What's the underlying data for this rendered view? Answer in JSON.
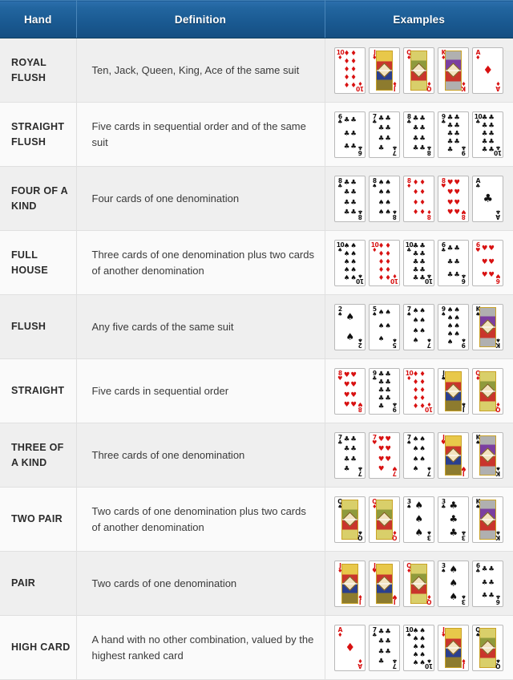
{
  "table": {
    "headers": [
      "Hand",
      "Definition",
      "Examples"
    ],
    "rows": [
      {
        "hand": "ROYAL FLUSH",
        "definition": "Ten, Jack, Queen, King, Ace of the same suit",
        "cards": [
          {
            "rank": "10",
            "suit": "diamonds"
          },
          {
            "rank": "J",
            "suit": "diamonds"
          },
          {
            "rank": "Q",
            "suit": "diamonds"
          },
          {
            "rank": "K",
            "suit": "diamonds"
          },
          {
            "rank": "A",
            "suit": "diamonds"
          }
        ]
      },
      {
        "hand": "STRAIGHT FLUSH",
        "definition": "Five cards in sequential order and of the same suit",
        "cards": [
          {
            "rank": "6",
            "suit": "clubs"
          },
          {
            "rank": "7",
            "suit": "clubs"
          },
          {
            "rank": "8",
            "suit": "clubs"
          },
          {
            "rank": "9",
            "suit": "clubs"
          },
          {
            "rank": "10",
            "suit": "clubs"
          }
        ]
      },
      {
        "hand": "FOUR OF A KIND",
        "definition": "Four cards of one denomination",
        "cards": [
          {
            "rank": "8",
            "suit": "clubs"
          },
          {
            "rank": "8",
            "suit": "spades"
          },
          {
            "rank": "8",
            "suit": "diamonds"
          },
          {
            "rank": "8",
            "suit": "hearts"
          },
          {
            "rank": "A",
            "suit": "clubs"
          }
        ]
      },
      {
        "hand": "FULL HOUSE",
        "definition": "Three cards of one denomination plus two cards of another denomination",
        "cards": [
          {
            "rank": "10",
            "suit": "spades"
          },
          {
            "rank": "10",
            "suit": "diamonds"
          },
          {
            "rank": "10",
            "suit": "clubs"
          },
          {
            "rank": "6",
            "suit": "clubs"
          },
          {
            "rank": "6",
            "suit": "hearts"
          }
        ]
      },
      {
        "hand": "FLUSH",
        "definition": "Any five cards of the same suit",
        "cards": [
          {
            "rank": "2",
            "suit": "spades"
          },
          {
            "rank": "5",
            "suit": "spades"
          },
          {
            "rank": "7",
            "suit": "spades"
          },
          {
            "rank": "9",
            "suit": "spades"
          },
          {
            "rank": "K",
            "suit": "spades"
          }
        ]
      },
      {
        "hand": "STRAIGHT",
        "definition": "Five cards in sequential order",
        "cards": [
          {
            "rank": "8",
            "suit": "hearts"
          },
          {
            "rank": "9",
            "suit": "clubs"
          },
          {
            "rank": "10",
            "suit": "diamonds"
          },
          {
            "rank": "J",
            "suit": "spades"
          },
          {
            "rank": "Q",
            "suit": "diamonds"
          }
        ]
      },
      {
        "hand": "THREE OF A KIND",
        "definition": "Three cards of one denomination",
        "cards": [
          {
            "rank": "7",
            "suit": "clubs"
          },
          {
            "rank": "7",
            "suit": "hearts"
          },
          {
            "rank": "7",
            "suit": "spades"
          },
          {
            "rank": "J",
            "suit": "hearts"
          },
          {
            "rank": "K",
            "suit": "spades"
          }
        ]
      },
      {
        "hand": "TWO PAIR",
        "definition": "Two cards of one denomination plus two cards of another denomination",
        "cards": [
          {
            "rank": "Q",
            "suit": "spades"
          },
          {
            "rank": "Q",
            "suit": "diamonds"
          },
          {
            "rank": "3",
            "suit": "spades"
          },
          {
            "rank": "3",
            "suit": "clubs"
          },
          {
            "rank": "K",
            "suit": "spades"
          }
        ]
      },
      {
        "hand": "PAIR",
        "definition": "Two cards of one denomination",
        "cards": [
          {
            "rank": "J",
            "suit": "diamonds"
          },
          {
            "rank": "J",
            "suit": "hearts"
          },
          {
            "rank": "Q",
            "suit": "diamonds"
          },
          {
            "rank": "3",
            "suit": "spades"
          },
          {
            "rank": "6",
            "suit": "clubs"
          }
        ]
      },
      {
        "hand": "HIGH CARD",
        "definition": "A hand with no other combination, valued by the highest ranked card",
        "cards": [
          {
            "rank": "A",
            "suit": "diamonds"
          },
          {
            "rank": "7",
            "suit": "clubs"
          },
          {
            "rank": "10",
            "suit": "spades"
          },
          {
            "rank": "J",
            "suit": "diamonds"
          },
          {
            "rank": "Q",
            "suit": "spades"
          }
        ]
      }
    ]
  },
  "style": {
    "header_color": "#1a5a92",
    "row_alt_color": "#efefef",
    "row_main_color": "#fafafa",
    "red_suit_color": "#d81111",
    "black_suit_color": "#111111"
  },
  "suit_glyphs": {
    "spades": "♠",
    "hearts": "♥",
    "diamonds": "♦",
    "clubs": "♣"
  }
}
